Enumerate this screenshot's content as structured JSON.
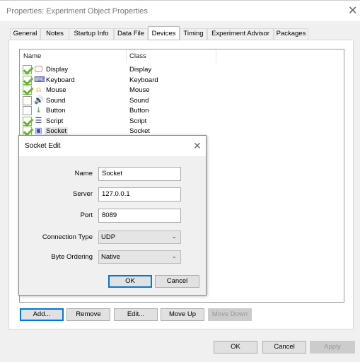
{
  "window": {
    "title": "Properties: Experiment Object Properties"
  },
  "tabs": [
    "General",
    "Notes",
    "Startup Info",
    "Data File",
    "Devices",
    "Timing",
    "Experiment Advisor",
    "Packages"
  ],
  "selected_tab": "Devices",
  "list": {
    "headers": [
      "Name",
      "Class"
    ],
    "rows": [
      {
        "name": "Display",
        "class": "Display",
        "checked": true,
        "icon": "monitor-icon",
        "color": "#d4002a"
      },
      {
        "name": "Keyboard",
        "class": "Keyboard",
        "checked": true,
        "icon": "keyboard-icon",
        "color": "#3a3a9a"
      },
      {
        "name": "Mouse",
        "class": "Mouse",
        "checked": true,
        "icon": "mouse-icon",
        "color": "#f08a1c"
      },
      {
        "name": "Sound",
        "class": "Sound",
        "checked": false,
        "icon": "speaker-icon",
        "color": "#2a9a3a"
      },
      {
        "name": "Button",
        "class": "Button",
        "checked": false,
        "icon": "button-icon",
        "color": "#2a8a3a"
      },
      {
        "name": "Script",
        "class": "Script",
        "checked": true,
        "icon": "script-icon",
        "color": "#3a3a9a"
      },
      {
        "name": "Socket",
        "class": "Socket",
        "checked": true,
        "icon": "socket-icon",
        "color": "#3f51b5"
      }
    ]
  },
  "list_buttons": {
    "add": "Add...",
    "remove": "Remove",
    "edit": "Edit...",
    "move_up": "Move Up",
    "move_down": "Move Down"
  },
  "footer": {
    "ok": "OK",
    "cancel": "Cancel",
    "apply": "Apply"
  },
  "socket_dialog": {
    "title": "Socket Edit",
    "name_label": "Name",
    "name_value": "Socket",
    "server_label": "Server",
    "server_value": "127.0.0.1",
    "port_label": "Port",
    "port_value": "8089",
    "connection_label": "Connection Type",
    "connection_value": "UDP",
    "byte_label": "Byte Ordering",
    "byte_value": "Native",
    "ok": "OK",
    "cancel": "Cancel"
  }
}
